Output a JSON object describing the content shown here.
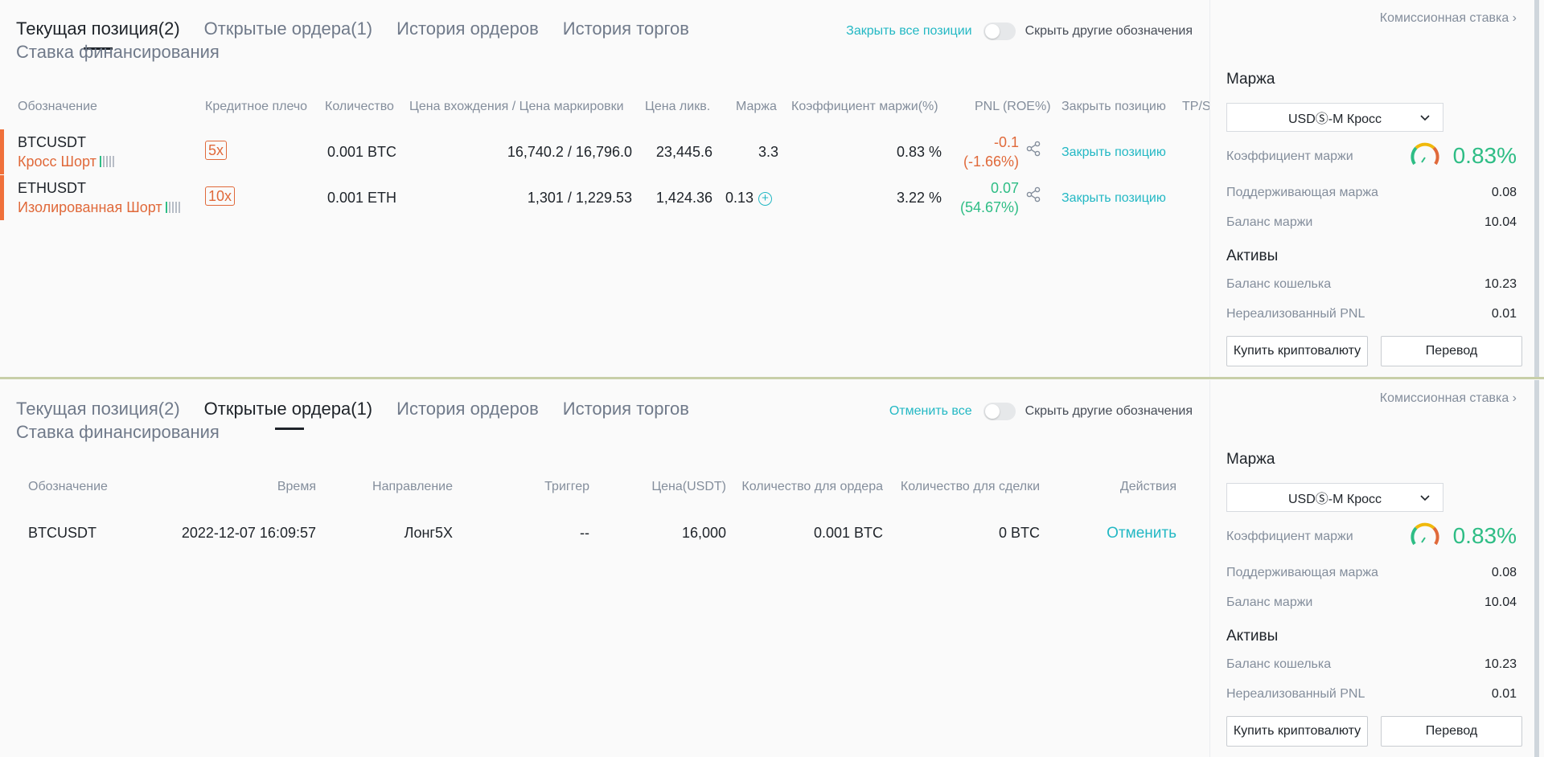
{
  "colors": {
    "accent_teal": "#23b8c4",
    "orange": "#e0693a",
    "green": "#2ebd85"
  },
  "top": {
    "tabs": [
      {
        "label": "Текущая позиция(2)",
        "active": true
      },
      {
        "label": "Открытые ордера(1)",
        "active": false
      },
      {
        "label": "История ордеров",
        "active": false
      },
      {
        "label": "История торгов",
        "active": false
      }
    ],
    "tab_funding": "Ставка финансирования",
    "action_link": "Закрыть все позиции",
    "hide_label": "Скрыть другие обозначения",
    "columns": [
      "Обозначение",
      "Кредитное плечо",
      "Количество",
      "Цена вхождения / Цена маркировки",
      "Цена ликв.",
      "Маржа",
      "Коэффициент маржи(%)",
      "PNL (ROE%)",
      "Закрыть позицию",
      "TP/S"
    ],
    "positions": [
      {
        "symbol": "BTCUSDT",
        "type": "Кросс Шорт",
        "leverage": "5x",
        "qty": "0.001 BTC",
        "prices": "16,740.2 / 16,796.0",
        "liq": "23,445.6",
        "margin": "3.3",
        "margin_ratio": "0.83 %",
        "pnl": "-0.1",
        "roe": "(-1.66%)",
        "close": "Закрыть позицию",
        "pnl_positive": false,
        "margin_add": false
      },
      {
        "symbol": "ETHUSDT",
        "type": "Изолированная Шорт",
        "leverage": "10x",
        "qty": "0.001 ETH",
        "prices": "1,301 / 1,229.53",
        "liq": "1,424.36",
        "margin": "0.13",
        "margin_ratio": "3.22 %",
        "pnl": "0.07",
        "roe": "(54.67%)",
        "close": "Закрыть позицию",
        "pnl_positive": true,
        "margin_add": true
      }
    ]
  },
  "bottom": {
    "tabs": [
      {
        "label": "Текущая позиция(2)",
        "active": false
      },
      {
        "label": "Открытые ордера(1)",
        "active": true
      },
      {
        "label": "История ордеров",
        "active": false
      },
      {
        "label": "История торгов",
        "active": false
      }
    ],
    "tab_funding": "Ставка финансирования",
    "action_link": "Отменить все",
    "hide_label": "Скрыть другие обозначения",
    "columns": [
      "Обозначение",
      "Время",
      "Направление",
      "Триггер",
      "Цена(USDT)",
      "Количество для ордера",
      "Количество для сделки",
      "Действия"
    ],
    "orders": [
      {
        "symbol": "BTCUSDT",
        "time": "2022-12-07 16:09:57",
        "direction": "Лонг5X",
        "trigger": "--",
        "price": "16,000",
        "order_qty": "0.001 BTC",
        "filled_qty": "0 BTC",
        "action": "Отменить"
      }
    ]
  },
  "side": {
    "fee_link": "Комиссионная ставка",
    "margin_title": "Маржа",
    "mode_select": "USDⓈ-M Кросс",
    "margin_ratio_label": "Коэффициент маржи",
    "margin_ratio_value": "0.83%",
    "maint_margin_label": "Поддерживающая маржа",
    "maint_margin_value": "0.08",
    "margin_balance_label": "Баланс маржи",
    "margin_balance_value": "10.04",
    "assets_title": "Активы",
    "wallet_balance_label": "Баланс кошелька",
    "wallet_balance_value": "10.23",
    "unrealized_pnl_label": "Нереализованный PNL",
    "unrealized_pnl_value": "0.01",
    "buy_crypto_button": "Купить криптовалюту",
    "transfer_button": "Перевод"
  }
}
